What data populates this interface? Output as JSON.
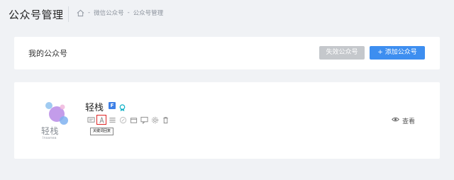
{
  "header": {
    "title": "公众号管理",
    "breadcrumb": [
      "微信公众号",
      "公众号管理"
    ],
    "breadcrumb_sep": "-"
  },
  "section": {
    "title": "我的公众号",
    "disabled_button": "失效公众号",
    "add_button": "添加公众号",
    "add_icon": "+"
  },
  "account": {
    "name": "轻栈",
    "logo_text": "轻栈",
    "logo_sub": "Insanea",
    "badge": "F",
    "view_label": "查看",
    "tools": [
      {
        "icon": "message-icon"
      },
      {
        "icon": "text-a-icon"
      },
      {
        "icon": "list-icon"
      },
      {
        "icon": "edit-icon"
      },
      {
        "icon": "box-icon"
      },
      {
        "icon": "chat-icon"
      },
      {
        "icon": "gear-icon"
      },
      {
        "icon": "trash-icon"
      }
    ],
    "tooltip": "关键词回复"
  },
  "colors": {
    "primary": "#3d8ef0",
    "disabled": "#c5c8cc",
    "highlight": "#dd2222"
  }
}
